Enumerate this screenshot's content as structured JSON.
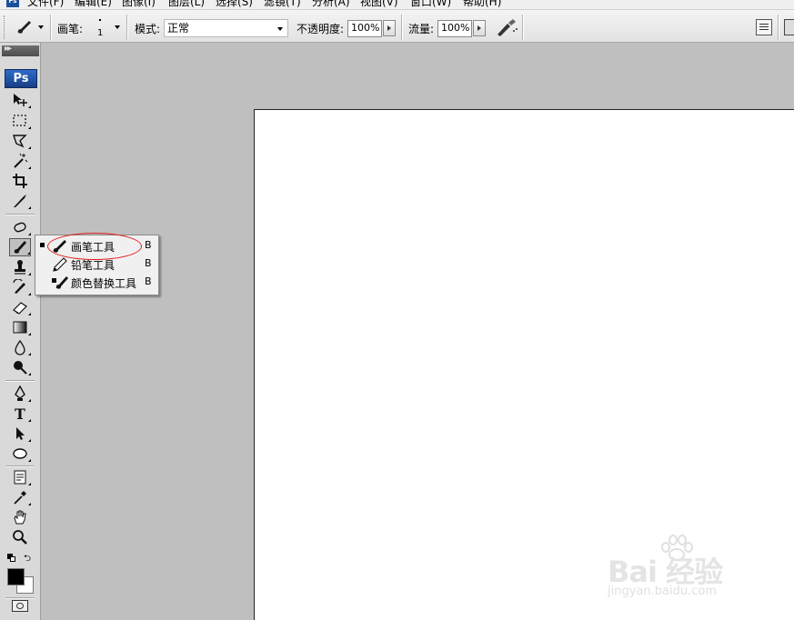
{
  "menubar": {
    "app_icon": "Ps",
    "items": [
      "文件(F)",
      "编辑(E)",
      "图像(I)",
      "图层(L)",
      "选择(S)",
      "滤镜(T)",
      "分析(A)",
      "视图(V)",
      "窗口(W)",
      "帮助(H)"
    ]
  },
  "options": {
    "brush_label": "画笔:",
    "brush_size": "1",
    "mode_label": "模式:",
    "mode_value": "正常",
    "opacity_label": "不透明度:",
    "opacity_value": "100%",
    "flow_label": "流量:",
    "flow_value": "100%"
  },
  "toolbox": {
    "logo": "Ps",
    "tools": [
      "move-tool",
      "marquee-tool",
      "lasso-tool",
      "magic-wand-tool",
      "crop-tool",
      "slice-tool",
      "healing-brush-tool",
      "brush-tool",
      "clone-stamp-tool",
      "history-brush-tool",
      "eraser-tool",
      "gradient-tool",
      "blur-tool",
      "dodge-tool",
      "pen-tool",
      "type-tool",
      "path-selection-tool",
      "shape-tool",
      "notes-tool",
      "eyedropper-tool",
      "hand-tool",
      "zoom-tool"
    ],
    "type_tool_glyph": "T"
  },
  "flyout": {
    "items": [
      {
        "label": "画笔工具",
        "key": "B",
        "selected": true,
        "icon": "brush-icon"
      },
      {
        "label": "铅笔工具",
        "key": "B",
        "selected": false,
        "icon": "pencil-icon"
      },
      {
        "label": "颜色替换工具",
        "key": "B",
        "selected": false,
        "icon": "color-replacement-icon"
      }
    ]
  },
  "colors": {
    "foreground": "#000000",
    "background": "#ffffff",
    "highlight": "#e02020"
  },
  "watermark": {
    "brand": "Bai  经验",
    "url": "jingyan.baidu.com"
  }
}
